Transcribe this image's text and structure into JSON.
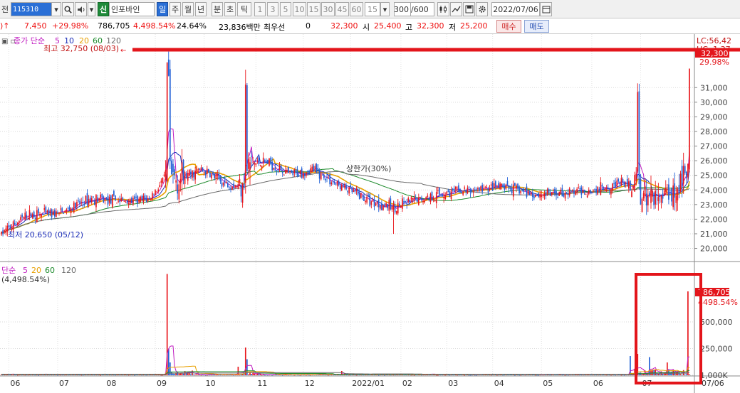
{
  "toolbar": {
    "period_label": "전",
    "stock_code": "115310",
    "credit_badge": "신",
    "stock_name": "인포바인",
    "periods": [
      "일",
      "주",
      "월",
      "년",
      "분",
      "초",
      "틱"
    ],
    "intervals": [
      "1",
      "3",
      "5",
      "10",
      "15",
      "30",
      "45",
      "60"
    ],
    "interval_value": "15",
    "count_value": "300",
    "count_total": "/600",
    "date_value": "2022/07/06"
  },
  "quote": {
    "change": "7,450",
    "change_pct": "+29.98%",
    "volume": "786,705",
    "volume_ratio": "4,498.54%",
    "turnover": "24.64%",
    "trade_value": "23,836백만",
    "best_label": "최우선",
    "best_value": "0",
    "price": "32,300",
    "open_label": "시",
    "open": "25,400",
    "high_label": "고",
    "high": "32,300",
    "low_label": "저",
    "low": "25,200",
    "buy_label": "매수",
    "sell_label": "매도"
  },
  "chart_legend": {
    "price_ma": "종가 단순",
    "ma_periods": [
      "5",
      "10",
      "20",
      "60",
      "120"
    ],
    "high_note": "최고 32,750 (08/03)",
    "low_note": "최저 20,650 (05/12)",
    "limit_note": "상한가(30%)",
    "lc": "LC:56,42",
    "hc": "HC: 1.37",
    "last_price": "32,300",
    "last_pct": "29.98%",
    "vol_ma": "단순",
    "vol_ma_periods": [
      "5",
      "20",
      "60",
      "120"
    ],
    "vol_ratio": "(4,498.54%)",
    "vol_last": "786,705",
    "vol_last_pct": "4498.54%"
  },
  "colors": {
    "up": "#e8161b",
    "down": "#1f5fd6",
    "ma5": "#c01bc0",
    "ma10": "#1d2fb8",
    "ma20": "#e8a000",
    "ma60": "#1b8a2a",
    "ma120": "#6a6a6a",
    "highlight": "#e3151b"
  },
  "chart_data": [
    {
      "type": "candlestick",
      "y_ticks": [
        "20,000",
        "21,000",
        "22,000",
        "23,000",
        "24,000",
        "25,000",
        "26,000",
        "27,000",
        "28,000",
        "29,000",
        "30,000",
        "31,000"
      ],
      "ylim": [
        19200,
        33200
      ],
      "x_ticks": [
        "06",
        "07",
        "08",
        "09",
        "10",
        "11",
        "12",
        "2022/01",
        "02",
        "03",
        "04",
        "05",
        "06",
        "07"
      ],
      "series": [
        {
          "name": "종가",
          "close_anchors": [
            [
              0,
              21000
            ],
            [
              18,
              22300
            ],
            [
              40,
              22400
            ],
            [
              60,
              23400
            ],
            [
              90,
              23200
            ],
            [
              100,
              23400
            ],
            [
              112,
              25000
            ],
            [
              120,
              24700
            ],
            [
              135,
              25400
            ],
            [
              150,
              24500
            ],
            [
              160,
              24300
            ],
            [
              168,
              25800
            ],
            [
              180,
              25900
            ],
            [
              195,
              25000
            ],
            [
              210,
              25400
            ],
            [
              228,
              24300
            ],
            [
              250,
              23200
            ],
            [
              265,
              22800
            ],
            [
              280,
              23300
            ],
            [
              300,
              23800
            ],
            [
              320,
              24000
            ],
            [
              340,
              24200
            ],
            [
              360,
              23700
            ],
            [
              380,
              23800
            ],
            [
              400,
              24000
            ],
            [
              418,
              24500
            ],
            [
              430,
              24000
            ],
            [
              440,
              23400
            ],
            [
              455,
              24200
            ],
            [
              465,
              25500
            ]
          ]
        }
      ]
    },
    {
      "type": "bar",
      "y_ticks": [
        "250,000",
        "500,000",
        "1,000K"
      ],
      "ylim": [
        0,
        1000000
      ],
      "series": [
        {
          "name": "거래량",
          "spikes": [
            [
              112,
              950000
            ],
            [
              113,
              250000
            ],
            [
              114,
              120000
            ],
            [
              160,
              80000
            ],
            [
              165,
              260000
            ],
            [
              166,
              150000
            ],
            [
              230,
              40000
            ],
            [
              425,
              180000
            ],
            [
              430,
              200000
            ],
            [
              438,
              170000
            ],
            [
              450,
              120000
            ],
            [
              464,
              786705
            ]
          ]
        }
      ]
    }
  ]
}
